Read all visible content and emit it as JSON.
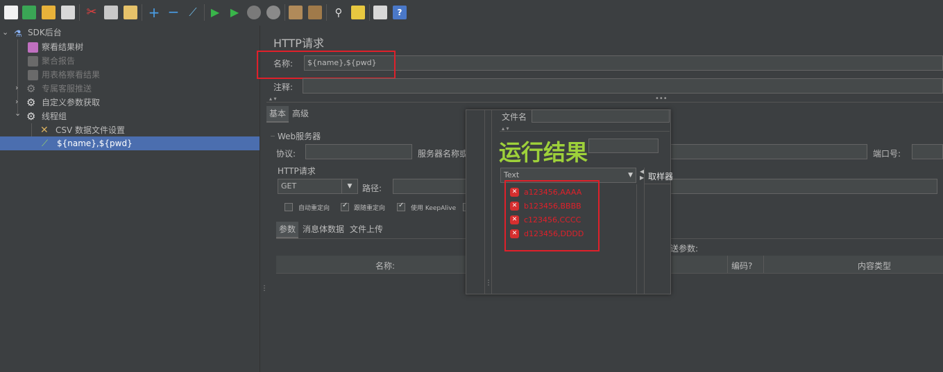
{
  "toolbar": {
    "icons": [
      "new-icon",
      "templates-icon",
      "open-icon",
      "save-icon",
      "cut-icon",
      "copy-icon",
      "paste-icon",
      "expand-icon",
      "collapse-icon",
      "toggle-icon",
      "start-icon",
      "start-no-pause-icon",
      "stop-icon",
      "shutdown-icon",
      "clear-icon",
      "clear-all-icon",
      "search-icon",
      "reset-search-icon",
      "function-helper-icon",
      "help-icon"
    ]
  },
  "tree": {
    "root": "SDK后台",
    "items": [
      {
        "label": "察看结果树"
      },
      {
        "label": "聚合报告"
      },
      {
        "label": "用表格察看结果"
      },
      {
        "label": "专属客服推送"
      },
      {
        "label": "自定义参数获取"
      },
      {
        "label": "线程组"
      },
      {
        "label": "CSV 数据文件设置"
      },
      {
        "label": "${name},${pwd}"
      }
    ]
  },
  "http": {
    "title": "HTTP请求",
    "name_label": "名称:",
    "name_value": "${name},${pwd}",
    "comment_label": "注释:",
    "tabs": {
      "basic": "基本",
      "advanced": "高级"
    },
    "web_server": "Web服务器",
    "protocol_label": "协议:",
    "server_label": "服务器名称或",
    "port_label": "端口号:",
    "http_request": "HTTP请求",
    "method": "GET",
    "path_label": "路径:",
    "options": {
      "auto_redirect": "自动重定向",
      "follow_redirect": "跟随重定向",
      "keepalive": "使用 KeepAlive"
    },
    "subtabs": {
      "params": "参数",
      "body": "消息体数据",
      "files": "文件上传"
    },
    "send_params": "送参数:",
    "columns": {
      "name": "名称:",
      "encode": "编码?",
      "content_type": "内容类型"
    }
  },
  "overlay": {
    "file_name_label": "文件名",
    "title": "运行结果",
    "renderer": "Text",
    "sampler_label": "取样器",
    "results": [
      "a123456,AAAA",
      "b123456,BBBB",
      "c123456,CCCC",
      "d123456,DDDD"
    ]
  }
}
